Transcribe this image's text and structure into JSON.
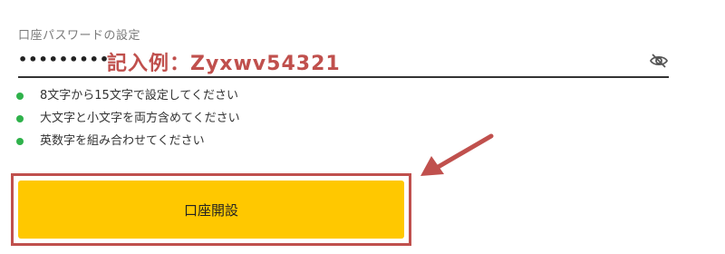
{
  "password_field": {
    "label": "口座パスワードの設定",
    "masked_value": "•••••••••",
    "example_annotation": "記入例：Zyxwv54321",
    "toggle_icon": "eye-off-icon"
  },
  "rules": [
    {
      "text": "8文字から15文字で設定してください"
    },
    {
      "text": "大文字と小文字を両方含めてください"
    },
    {
      "text": "英数字を組み合わせてください"
    }
  ],
  "submit": {
    "label": "口座開設"
  },
  "colors": {
    "accent_annotation": "#c0504d",
    "button_bg": "#ffc800",
    "bullet": "#2fb24b",
    "underline": "#333333"
  },
  "annotation": {
    "arrow_icon": "arrow-pointing-down-left"
  }
}
